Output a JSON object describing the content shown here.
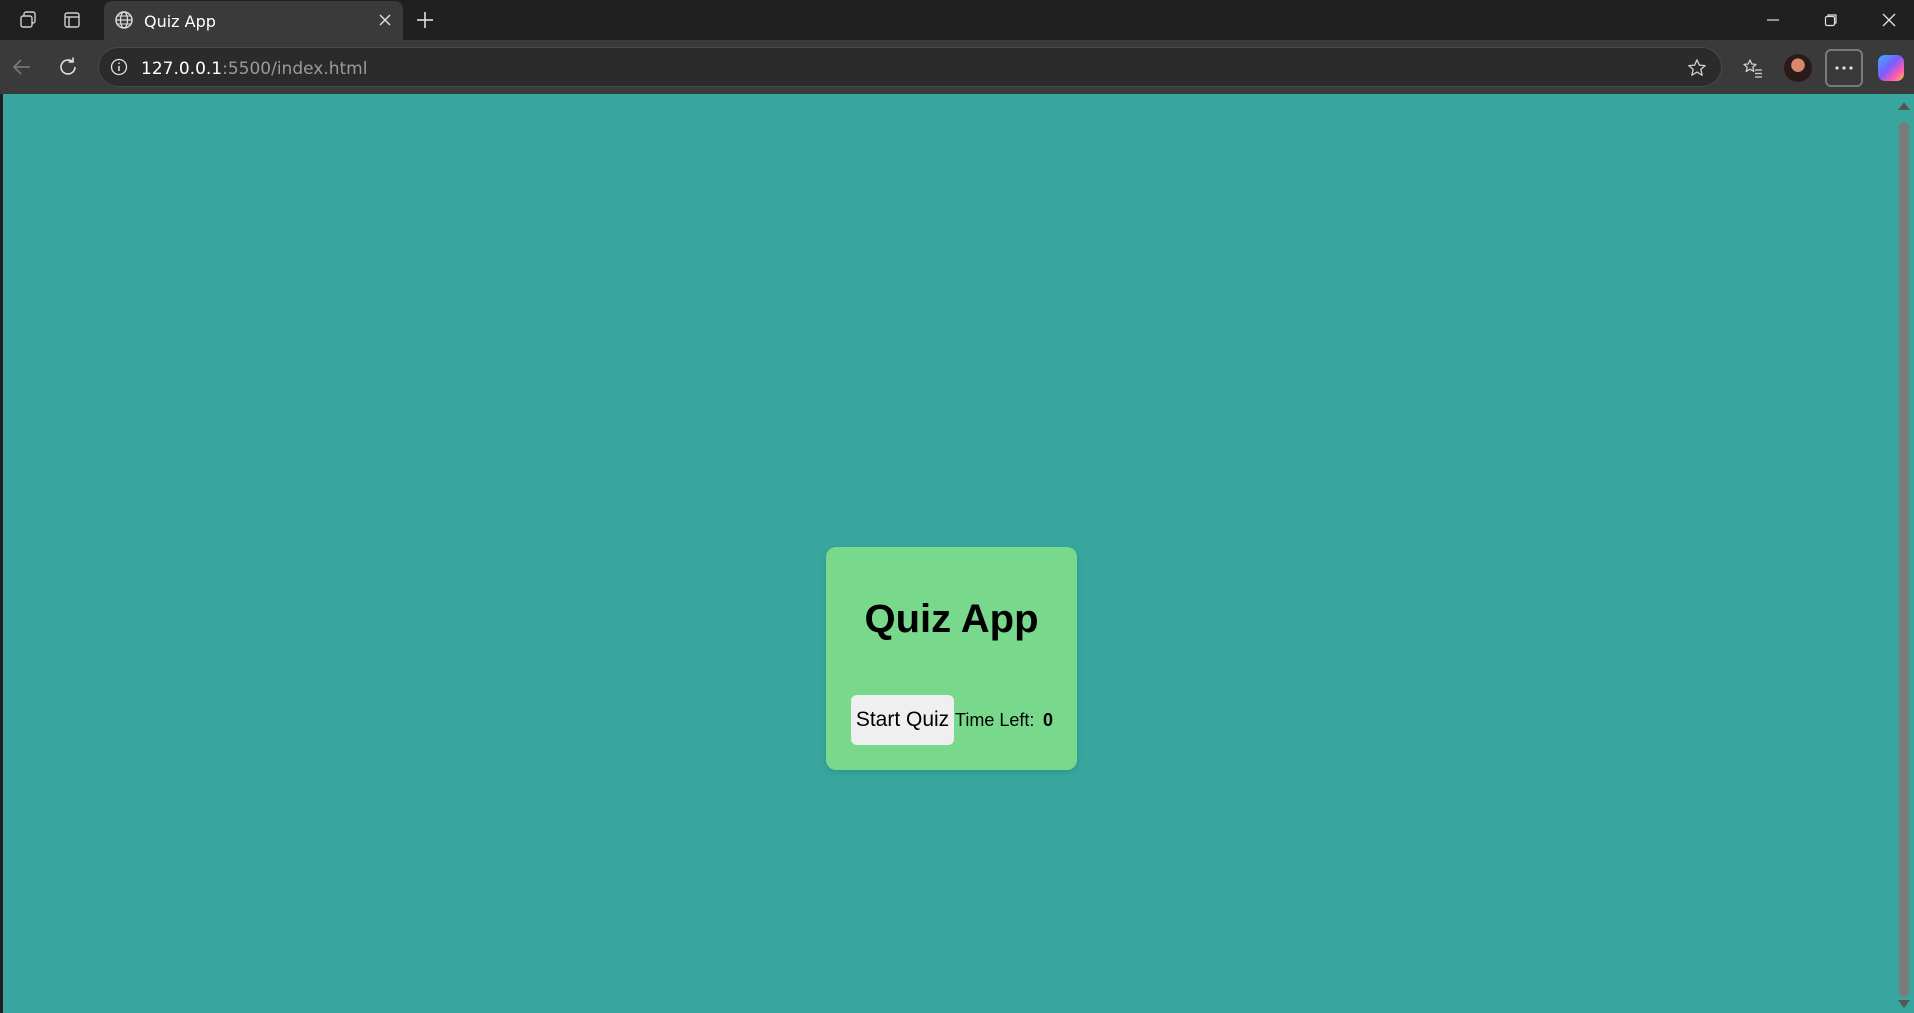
{
  "browser": {
    "tab": {
      "title": "Quiz App"
    },
    "address": {
      "host": "127.0.0.1",
      "rest": ":5500/index.html"
    }
  },
  "page": {
    "background_color": "#38a69e",
    "card_color": "#78d88b",
    "title": "Quiz App",
    "start_button_label": "Start Quiz",
    "time_left_label": "Time Left:",
    "time_left_value": "0"
  }
}
